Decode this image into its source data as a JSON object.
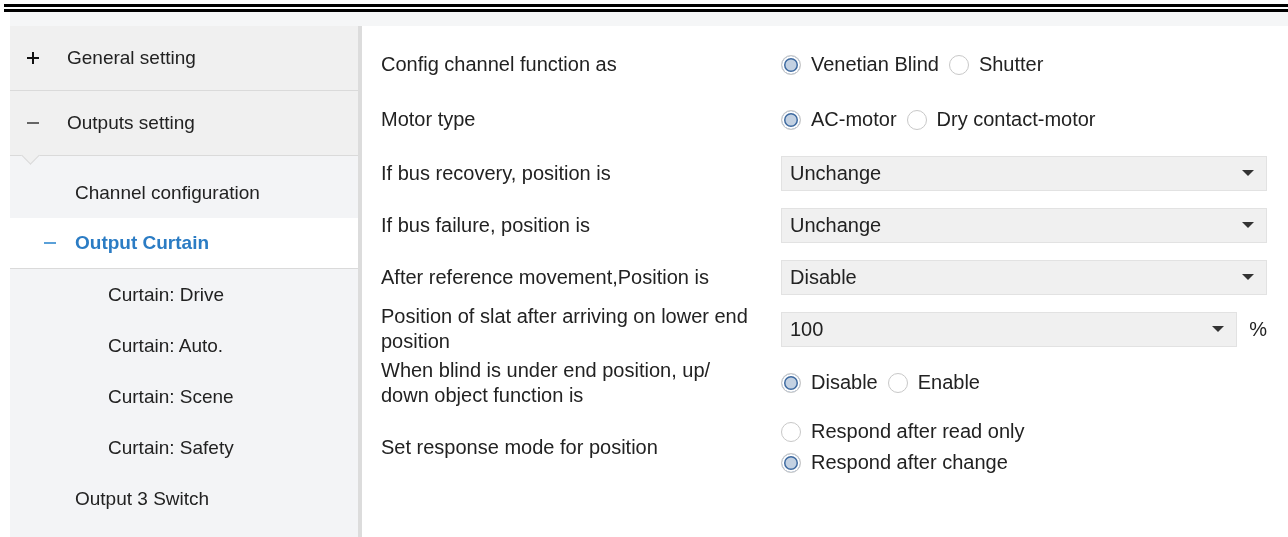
{
  "sidebar": {
    "items": [
      {
        "label": "General setting",
        "expanded": false,
        "selected": false
      },
      {
        "label": "Outputs setting",
        "expanded": true,
        "selected": false,
        "children": [
          {
            "label": "Channel configuration",
            "selected": false
          },
          {
            "label": "Output Curtain",
            "expanded": true,
            "selected": true,
            "children": [
              {
                "label": "Curtain: Drive",
                "selected": false
              },
              {
                "label": "Curtain: Auto.",
                "selected": false
              },
              {
                "label": "Curtain: Scene",
                "selected": false
              },
              {
                "label": "Curtain: Safety",
                "selected": false
              }
            ]
          },
          {
            "label": "Output 3 Switch",
            "selected": false
          }
        ]
      }
    ]
  },
  "parameters": [
    {
      "kind": "radio",
      "label": "Config channel function as",
      "options": [
        {
          "label": "Venetian Blind",
          "selected": true
        },
        {
          "label": "Shutter",
          "selected": false
        }
      ]
    },
    {
      "kind": "radio",
      "label": "Motor type",
      "options": [
        {
          "label": "AC-motor",
          "selected": true
        },
        {
          "label": "Dry contact-motor",
          "selected": false
        }
      ]
    },
    {
      "kind": "select",
      "label": "If bus recovery, position is",
      "value": "Unchange"
    },
    {
      "kind": "select",
      "label": "If bus failure, position is",
      "value": "Unchange"
    },
    {
      "kind": "select",
      "label": "After reference movement,Position is",
      "value": "Disable"
    },
    {
      "kind": "select",
      "label": "Position of slat after arriving on lower end position",
      "value": "100",
      "unit": "%"
    },
    {
      "kind": "radio",
      "label": "When blind is under end position, up/ down object function is",
      "options": [
        {
          "label": "Disable",
          "selected": true
        },
        {
          "label": "Enable",
          "selected": false
        }
      ]
    },
    {
      "kind": "radio_list",
      "label": "Set response mode for position",
      "options": [
        {
          "label": "Respond after read only",
          "selected": false
        },
        {
          "label": "Respond after change",
          "selected": true
        }
      ]
    }
  ]
}
